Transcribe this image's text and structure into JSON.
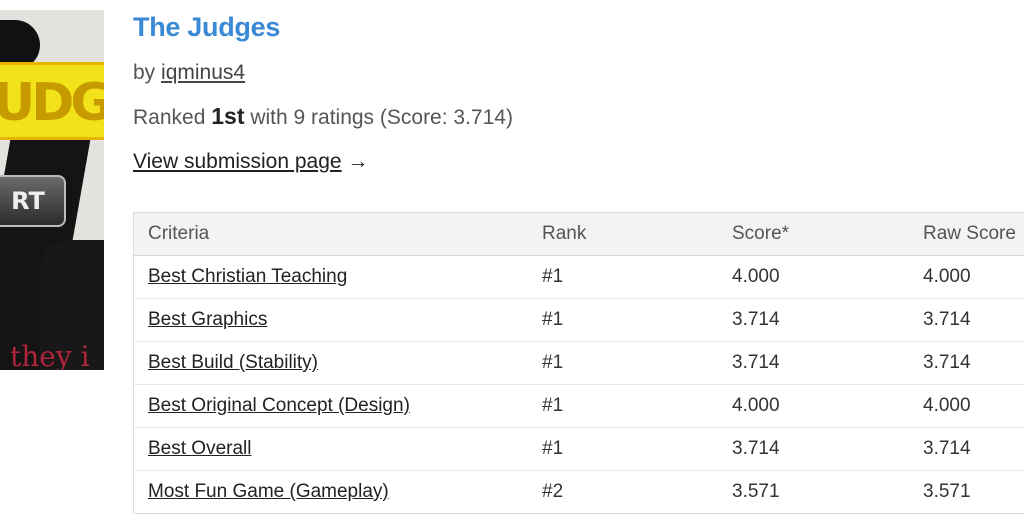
{
  "cover": {
    "logo_text": "UDGE",
    "badge_text": "RT",
    "tagline": "they i"
  },
  "game": {
    "title": "The Judges",
    "by_prefix": "by",
    "author": "iqminus4",
    "ranked_prefix": "Ranked",
    "rank": "1st",
    "ranked_suffix": "with 9 ratings (Score: 3.714)",
    "view_link": "View submission page",
    "view_arrow": "→"
  },
  "table": {
    "headers": [
      "Criteria",
      "Rank",
      "Score*",
      "Raw Score"
    ],
    "rows": [
      {
        "criteria": "Best Christian Teaching",
        "rank": "#1",
        "score": "4.000",
        "raw": "4.000"
      },
      {
        "criteria": "Best Graphics",
        "rank": "#1",
        "score": "3.714",
        "raw": "3.714"
      },
      {
        "criteria": "Best Build (Stability)",
        "rank": "#1",
        "score": "3.714",
        "raw": "3.714"
      },
      {
        "criteria": "Best Original Concept (Design)",
        "rank": "#1",
        "score": "4.000",
        "raw": "4.000"
      },
      {
        "criteria": "Best Overall",
        "rank": "#1",
        "score": "3.714",
        "raw": "3.714"
      },
      {
        "criteria": "Most Fun Game (Gameplay)",
        "rank": "#2",
        "score": "3.571",
        "raw": "3.571"
      }
    ]
  },
  "colors": {
    "title": "#3a89d6",
    "header_bg": "#f3f3f3"
  }
}
